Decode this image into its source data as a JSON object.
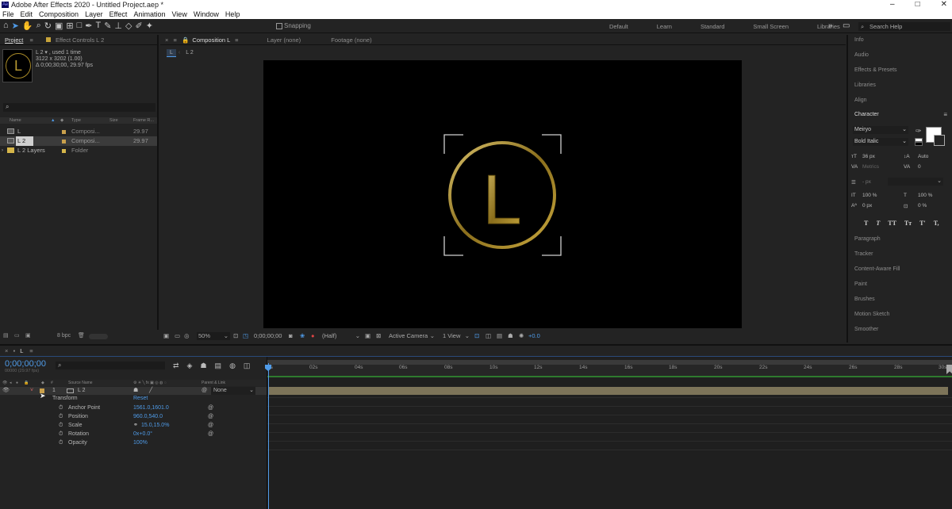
{
  "window": {
    "title": "Adobe After Effects 2020 - Untitled Project.aep *",
    "controls": [
      "–",
      "□",
      "✕"
    ]
  },
  "menu": [
    "File",
    "Edit",
    "Composition",
    "Layer",
    "Effect",
    "Animation",
    "View",
    "Window",
    "Help"
  ],
  "toolbar": {
    "snapping": "Snapping",
    "workspaces": [
      "Default",
      "Learn",
      "Standard",
      "Small Screen",
      "Libraries"
    ],
    "search_placeholder": "Search Help"
  },
  "project": {
    "tabs": [
      "Project",
      "Effect Controls L 2"
    ],
    "preview": {
      "letter": "L",
      "name": "L 2 ▾ , used 1 time",
      "size": "3122 x 3202 (1.00)",
      "duration": "Δ 0;00;30;00, 29.97 fps"
    },
    "columns": [
      "Name",
      "Type",
      "Size",
      "Frame R..."
    ],
    "items": [
      {
        "name": "L",
        "type": "Composi...",
        "fps": "29.97"
      },
      {
        "name": "L 2",
        "type": "Composi...",
        "fps": "29.97"
      },
      {
        "name": "L 2 Layers",
        "type": "Folder",
        "fps": ""
      }
    ],
    "bpc": "8 bpc"
  },
  "composition": {
    "tabs": [
      "Composition L",
      "Layer (none)",
      "Footage (none)"
    ],
    "breadcrumb": [
      "L",
      "L 2"
    ],
    "logo_letter": "L",
    "footer": {
      "zoom": "50%",
      "timecode": "0;00;00;00",
      "resolution": "(Half)",
      "camera": "Active Camera",
      "views": "1 View",
      "exposure": "+0.0"
    }
  },
  "right_panel": {
    "top_items": [
      "Info",
      "Audio",
      "Effects & Presets",
      "Libraries",
      "Align"
    ],
    "character": {
      "title": "Character",
      "font": "Meiryo",
      "style": "Bold Italic",
      "size": "36 px",
      "leading": "Auto",
      "kerning": "Metrics",
      "tracking": "0",
      "stroke": "- px",
      "vscale": "100 %",
      "hscale": "100 %",
      "baseline": "0 px",
      "tsume": "0 %",
      "styles": [
        "T",
        "T",
        "TT",
        "Tт",
        "T'",
        "T,"
      ]
    },
    "bottom_items": [
      "Paragraph",
      "Tracker",
      "Content-Aware Fill",
      "Paint",
      "Brushes",
      "Motion Sketch",
      "Smoother"
    ]
  },
  "timeline": {
    "tab": "L",
    "timecode": "0;00;00;00",
    "timecode_sub": "00000 (29.97 fps)",
    "columns": {
      "source": "Source Name",
      "parent": "Parent & Link"
    },
    "layer": {
      "num": "1",
      "name": "L 2",
      "parent": "None"
    },
    "transform": {
      "label": "Transform",
      "reset": "Reset"
    },
    "properties": [
      {
        "name": "Anchor Point",
        "value": "1561.0,1601.0"
      },
      {
        "name": "Position",
        "value": "960.0,540.0"
      },
      {
        "name": "Scale",
        "value": "15.0,15.0%"
      },
      {
        "name": "Rotation",
        "value": "0x+0.0°"
      },
      {
        "name": "Opacity",
        "value": "100%"
      }
    ],
    "ruler": [
      "0s",
      "02s",
      "04s",
      "06s",
      "08s",
      "10s",
      "12s",
      "14s",
      "16s",
      "18s",
      "20s",
      "22s",
      "24s",
      "26s",
      "28s",
      "30s"
    ]
  }
}
